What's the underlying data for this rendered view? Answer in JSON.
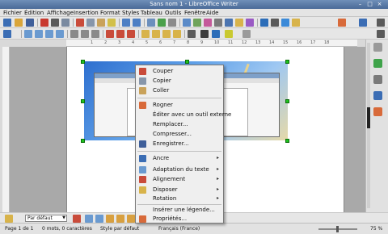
{
  "window": {
    "title": "Sans nom 1 - LibreOffice Writer"
  },
  "menubar": {
    "items": [
      "Fichier",
      "Édition",
      "Affichage",
      "Insertion",
      "Format",
      "Styles",
      "Tableau",
      "Outils",
      "Fenêtre",
      "Aide"
    ]
  },
  "context_menu": {
    "items": [
      {
        "label": "Couper",
        "icon": "cut-icon",
        "submenu": false
      },
      {
        "label": "Copier",
        "icon": "copy-icon",
        "submenu": false
      },
      {
        "label": "Coller",
        "icon": "paste-icon",
        "submenu": false
      },
      {
        "label": "Rogner",
        "icon": "crop-icon",
        "submenu": false
      },
      {
        "label": "Éditer avec un outil externe",
        "icon": "",
        "submenu": false
      },
      {
        "label": "Remplacer...",
        "icon": "",
        "submenu": false
      },
      {
        "label": "Compresser...",
        "icon": "",
        "submenu": false
      },
      {
        "label": "Enregistrer...",
        "icon": "save-icon",
        "submenu": false
      },
      {
        "label": "Ancre",
        "icon": "anchor-icon",
        "submenu": true
      },
      {
        "label": "Adaptation du texte",
        "icon": "wrap-icon",
        "submenu": true
      },
      {
        "label": "Alignement",
        "icon": "align-icon",
        "submenu": true
      },
      {
        "label": "Disposer",
        "icon": "arrange-icon",
        "submenu": true
      },
      {
        "label": "Rotation",
        "icon": "",
        "submenu": true
      },
      {
        "label": "Insérer une légende...",
        "icon": "",
        "submenu": false
      },
      {
        "label": "Propriétés...",
        "icon": "properties-icon",
        "submenu": false
      }
    ]
  },
  "drawbar": {
    "style_select": "Par défaut"
  },
  "statusbar": {
    "page": "Page 1 de 1",
    "words": "0 mots, 0 caractères",
    "style": "Style par défaut",
    "language": "Français (France)",
    "zoom": "75 %"
  },
  "ruler": {
    "ticks": [
      "1",
      "2",
      "3",
      "4",
      "5",
      "6",
      "7",
      "8",
      "9",
      "10",
      "11",
      "12",
      "13",
      "14",
      "15",
      "16",
      "17",
      "18"
    ]
  },
  "colors": {
    "titlebar": "#5a7aa7",
    "menu_bg": "#efefef",
    "handle": "#1ec21e"
  }
}
